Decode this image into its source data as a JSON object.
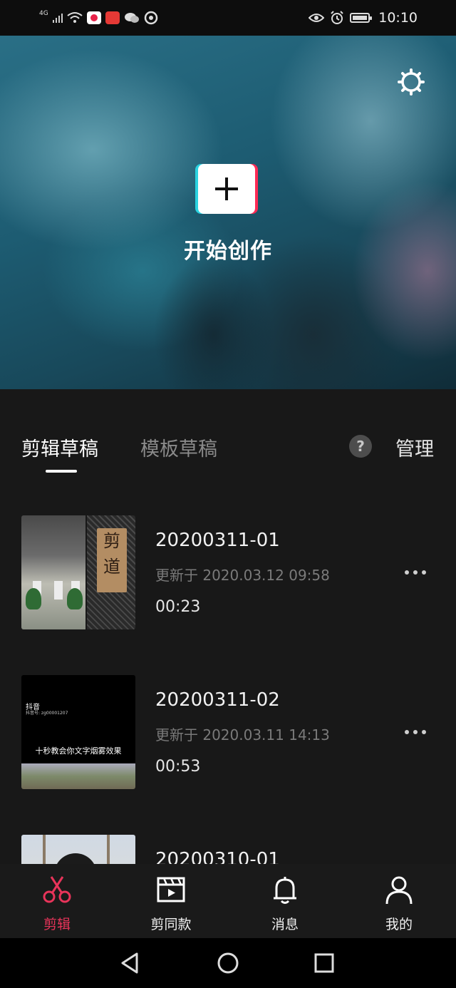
{
  "status_bar": {
    "network": "4G",
    "time": "10:10",
    "icons": [
      "signal-icon",
      "wifi-icon",
      "app-icon",
      "app-icon",
      "wechat-icon",
      "app-icon",
      "eye-icon",
      "alarm-icon",
      "battery-icon"
    ]
  },
  "hero": {
    "create_label": "开始创作"
  },
  "tabs": {
    "items": [
      {
        "label": "剪辑草稿",
        "active": true
      },
      {
        "label": "模板草稿",
        "active": false
      }
    ],
    "help_label": "?",
    "manage_label": "管理"
  },
  "drafts": [
    {
      "title": "20200311-01",
      "updated": "更新于 2020.03.12 09:58",
      "duration": "00:23",
      "thumb_text": "剪道"
    },
    {
      "title": "20200311-02",
      "updated": "更新于 2020.03.11 14:13",
      "duration": "00:53",
      "thumb_logo": "抖音",
      "thumb_id": "抖音号: zg00001207",
      "thumb_caption": "十秒教会你文字烟雾效果"
    },
    {
      "title": "20200310-01",
      "updated": "",
      "duration": ""
    }
  ],
  "bottom_nav": {
    "items": [
      {
        "label": "剪辑",
        "active": true,
        "icon": "scissors-icon"
      },
      {
        "label": "剪同款",
        "active": false,
        "icon": "clapper-icon"
      },
      {
        "label": "消息",
        "active": false,
        "icon": "bell-icon"
      },
      {
        "label": "我的",
        "active": false,
        "icon": "person-icon"
      }
    ]
  },
  "colors": {
    "accent": "#e8345a",
    "background": "#181818",
    "cyan": "#2ad2e0",
    "red": "#ff2a55"
  }
}
